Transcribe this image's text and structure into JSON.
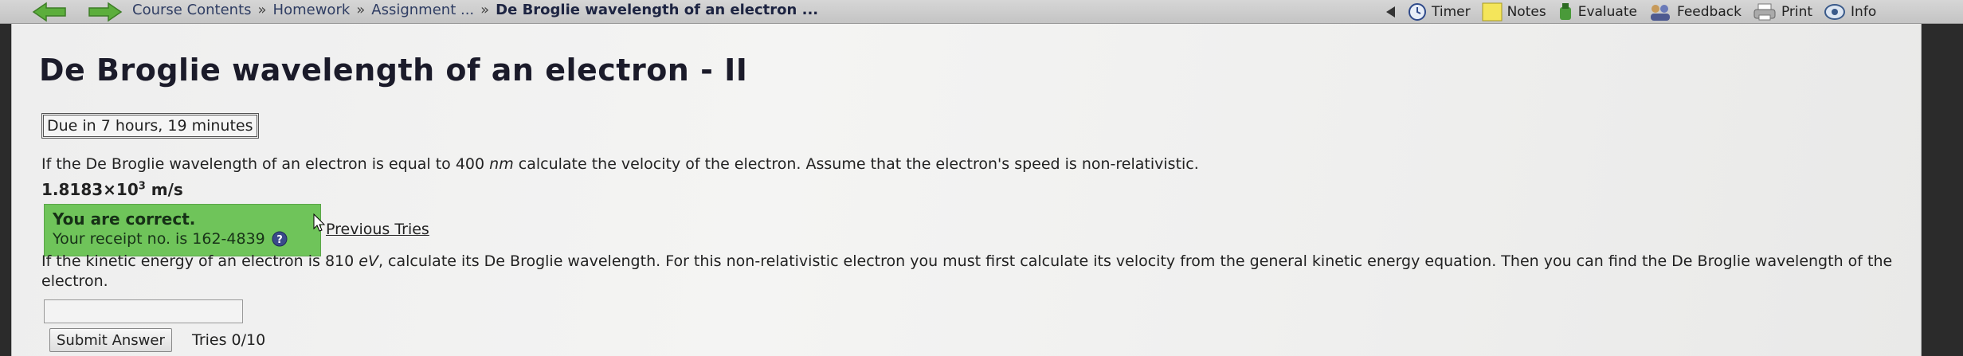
{
  "breadcrumb": {
    "items": [
      "Course Contents",
      "Homework",
      "Assignment ..."
    ],
    "separator": "»",
    "current": "De Broglie wavelength of an electron ..."
  },
  "toolbar": {
    "timer": "Timer",
    "notes": "Notes",
    "evaluate": "Evaluate",
    "feedback": "Feedback",
    "print": "Print",
    "info": "Info"
  },
  "page": {
    "title": "De Broglie wavelength of an electron - II",
    "due": "Due in 7 hours, 19 minutes"
  },
  "question1": {
    "text_before": "If the De Broglie wavelength of an electron is equal to 400 ",
    "unit": "nm",
    "text_after": " calculate the velocity of the electron. Assume that the electron's speed is non-relativistic.",
    "answer_mantissa": "1.8183×10",
    "answer_exponent": "3",
    "answer_unit": " m/s",
    "correct_msg": "You are correct.",
    "receipt": "Your receipt no. is 162-4839",
    "previous_tries": "Previous Tries"
  },
  "question2": {
    "text_before": "If the kinetic energy of an electron is 810 ",
    "unit": "eV",
    "text_after": ", calculate its De Broglie wavelength. For this non-relativistic electron you must first calculate its velocity from the general kinetic energy equation. Then you can find the De Broglie wavelength of the electron.",
    "input_value": "",
    "submit_label": "Submit Answer",
    "tries": "Tries 0/10"
  },
  "colors": {
    "correct_bg": "#6fc45a",
    "nav_arrow": "#5cae3c",
    "title": "#1b1b2a"
  }
}
